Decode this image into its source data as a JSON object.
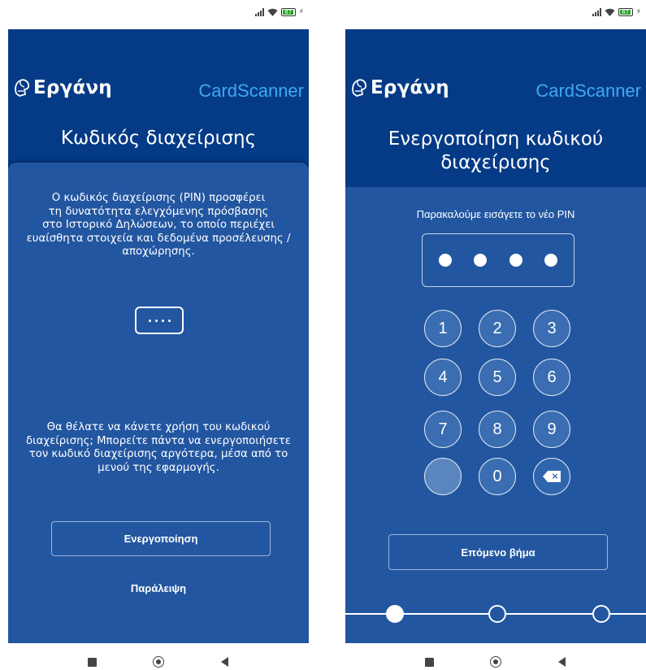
{
  "status_bar": {
    "battery_level": "87",
    "icons": [
      "signal-icon",
      "wifi-icon",
      "battery-icon",
      "charging-icon"
    ]
  },
  "brand": {
    "logo_text": "Εργάνη",
    "app_name": "CardScanner",
    "app_name_color": "#3fa9f0"
  },
  "colors": {
    "header_bg": "#053a86",
    "body_bg": "#2256a0"
  },
  "screen_intro": {
    "title": "Κωδικός διαχείρισης",
    "intro_lines": [
      "Ο κωδικός διαχείρισης (PIN) προσφέρει",
      "τη δυνατότητα ελεγχόμενης πρόσβασης",
      "στο Ιστορικό Δηλώσεων, το οποίο περιέχει",
      "ευαίσθητα στοιχεία και δεδομένα προσέλευσης /",
      "αποχώρησης."
    ],
    "question_lines": [
      "Θα θέλατε να κάνετε χρήση του κωδικού",
      "διαχείρισης; Μπορείτε πάντα να ενεργοποιήσετε",
      "τον κωδικό διαχείρισης αργότερα, μέσα από το",
      "μενού της εφαρμογής."
    ],
    "activate_button": "Ενεργοποίηση",
    "skip_link": "Παράλειψη"
  },
  "screen_pin": {
    "title_lines": [
      "Ενεργοποίηση κωδικού",
      "διαχείρισης"
    ],
    "prompt": "Παρακαλούμε εισάγετε το νέο PIN",
    "entered_digits": 4,
    "keypad": [
      "1",
      "2",
      "3",
      "4",
      "5",
      "6",
      "7",
      "8",
      "9",
      "",
      "0",
      "backspace"
    ],
    "next_button": "Επόμενο βήμα",
    "steps_total": 3,
    "current_step": 1
  },
  "nav_bar": {
    "icons": [
      "recents-icon",
      "home-icon",
      "back-icon"
    ]
  }
}
